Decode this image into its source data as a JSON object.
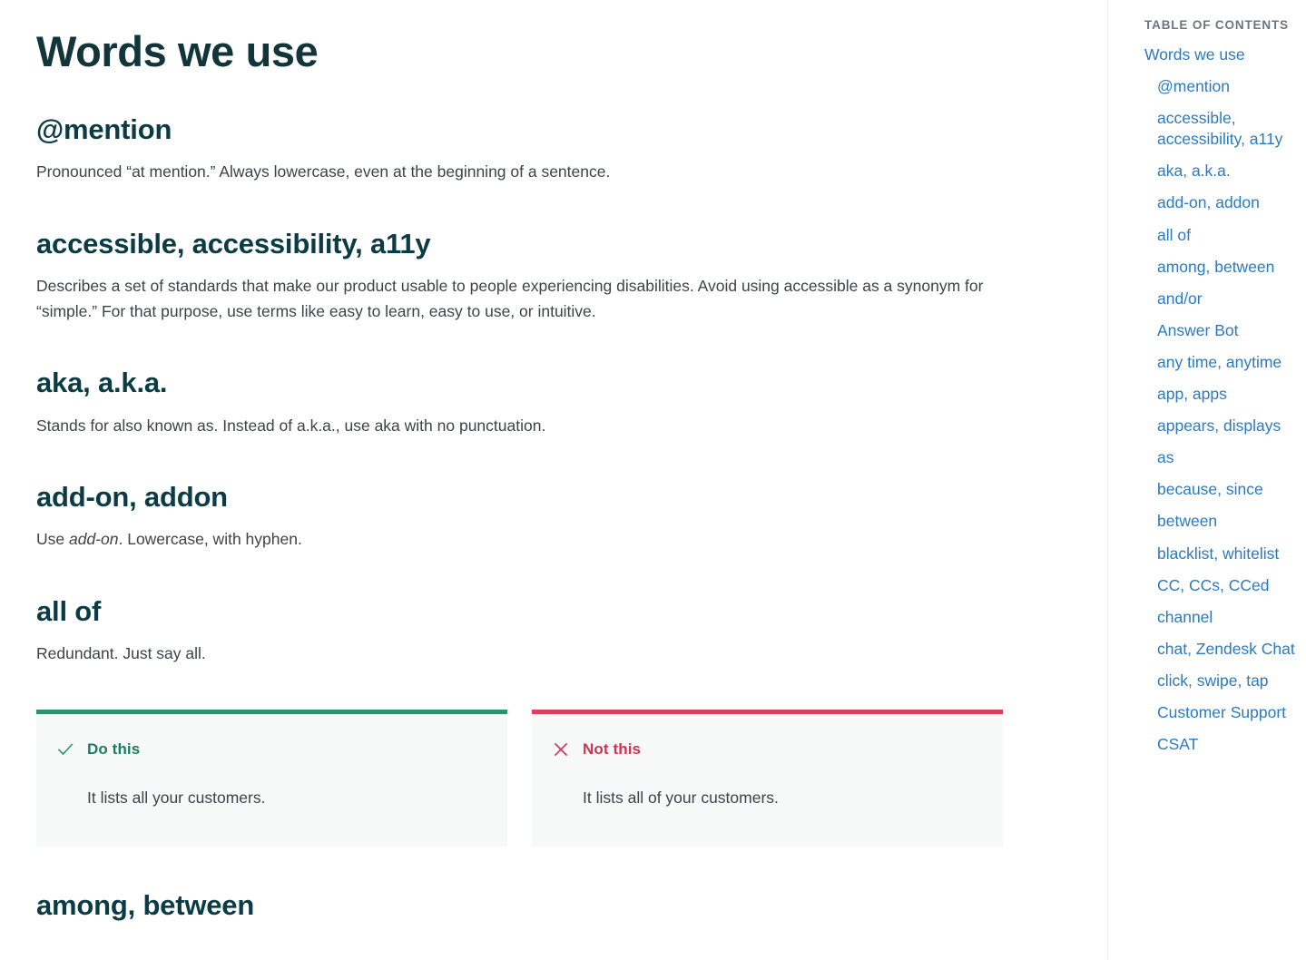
{
  "article": {
    "title": "Words we use",
    "sections": [
      {
        "heading": "@mention",
        "body_pre": "Pronounced “at mention.” Always lowercase, even at the beginning of a sentence.",
        "body_em": "",
        "body_post": ""
      },
      {
        "heading": "accessible, accessibility, a11y",
        "body_pre": "Describes a set of standards that make our product usable to people experiencing disabilities. Avoid using accessible as a synonym for “simple.” For that purpose, use terms like easy to learn, easy to use, or intuitive.",
        "body_em": "",
        "body_post": ""
      },
      {
        "heading": "aka, a.k.a.",
        "body_pre": "Stands for also known as. Instead of a.k.a., use aka with no punctuation.",
        "body_em": "",
        "body_post": ""
      },
      {
        "heading": "add-on, addon",
        "body_pre": "Use ",
        "body_em": "add-on",
        "body_post": ". Lowercase, with hyphen."
      },
      {
        "heading": "all of",
        "body_pre": "Redundant. Just say all.",
        "body_em": "",
        "body_post": ""
      }
    ],
    "trailing_heading": "among, between"
  },
  "callouts": {
    "positive": {
      "icon": "check-icon",
      "label": "Do this",
      "text": "It lists all your customers.",
      "accent_color": "#2e9170",
      "label_color": "#17805e"
    },
    "negative": {
      "icon": "x-icon",
      "label": "Not this",
      "text": "It lists all of your customers.",
      "accent_color": "#d9405a",
      "label_color": "#cf3350"
    },
    "background_color": "#f7f8f8"
  },
  "toc": {
    "title": "Table of contents",
    "link_color": "#2c7ac0",
    "items": [
      {
        "label": "Words we use",
        "level": 1
      },
      {
        "label": "@mention",
        "level": 2
      },
      {
        "label": "accessible, accessibility, a11y",
        "level": 2
      },
      {
        "label": "aka, a.k.a.",
        "level": 2
      },
      {
        "label": "add-on, addon",
        "level": 2
      },
      {
        "label": "all of",
        "level": 2
      },
      {
        "label": "among, between",
        "level": 2
      },
      {
        "label": "and/or",
        "level": 2
      },
      {
        "label": "Answer Bot",
        "level": 2
      },
      {
        "label": "any time, anytime",
        "level": 2
      },
      {
        "label": "app, apps",
        "level": 2
      },
      {
        "label": "appears, displays",
        "level": 2
      },
      {
        "label": "as",
        "level": 2
      },
      {
        "label": "because, since",
        "level": 2
      },
      {
        "label": "between",
        "level": 2
      },
      {
        "label": "blacklist, whitelist",
        "level": 2
      },
      {
        "label": "CC, CCs, CCed",
        "level": 2
      },
      {
        "label": "channel",
        "level": 2
      },
      {
        "label": "chat, Zendesk Chat",
        "level": 2
      },
      {
        "label": "click, swipe, tap",
        "level": 2
      },
      {
        "label": "Customer Support",
        "level": 2
      },
      {
        "label": "CSAT",
        "level": 2
      }
    ]
  },
  "theme": {
    "heading_color": "#0b3b45",
    "body_color": "#3f4347",
    "divider_color": "#ededee"
  }
}
